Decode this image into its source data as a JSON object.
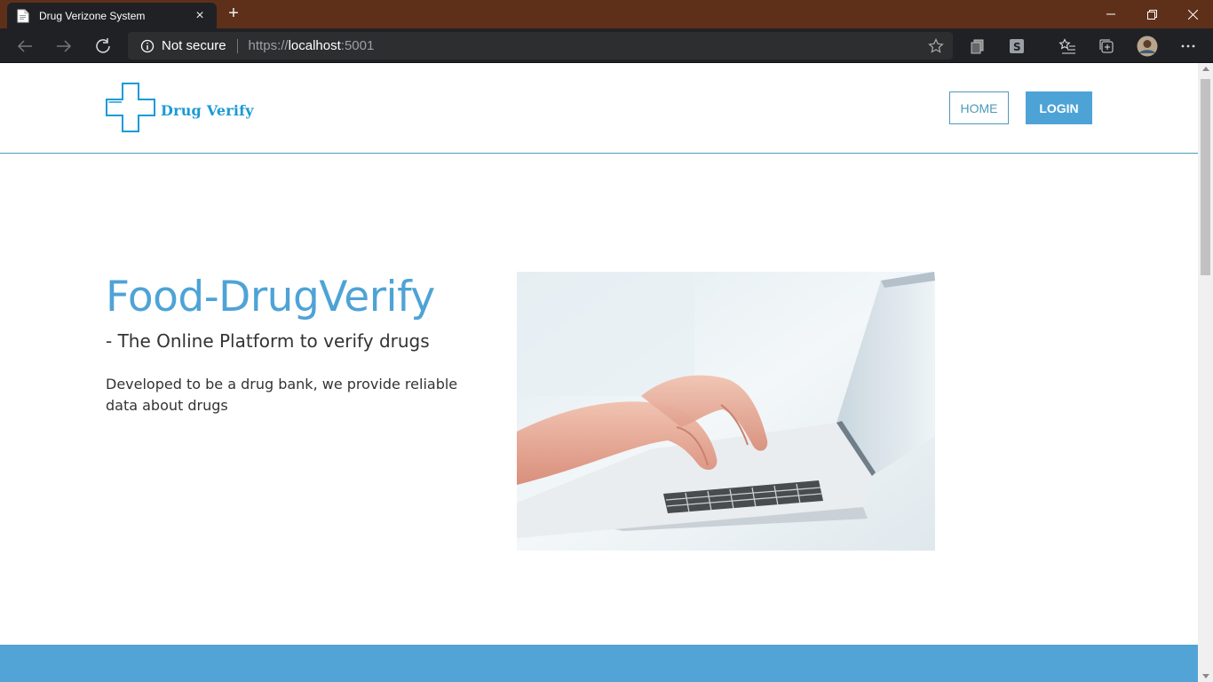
{
  "browser": {
    "tab_title": "Drug Verizone System",
    "new_tab_symbol": "+",
    "close_symbol": "×",
    "security_label": "Not secure",
    "url_prefix": "https://",
    "url_host": "localhost",
    "url_port": ":5001"
  },
  "site": {
    "logo_text": "Drug Verify",
    "nav": {
      "home_label": "HOME",
      "login_label": "LOGIN"
    },
    "hero": {
      "title": "Food-DrugVerify",
      "subtitle": "- The Online Platform to verify drugs",
      "description": "Developed to be a drug bank, we provide reliable data about drugs"
    }
  },
  "colors": {
    "accent": "#4ea3d6",
    "titlebar": "#5e301a",
    "toolbar": "#202124",
    "logo_blue": "#1a9ad6"
  },
  "icons": [
    "page-icon",
    "back-icon",
    "forward-icon",
    "refresh-icon",
    "info-icon",
    "star-icon",
    "collections-icon",
    "extension-icon",
    "favorites-icon",
    "tab-actions-icon",
    "profile-icon",
    "more-icon",
    "medical-cross-icon",
    "laptop-typing-image"
  ]
}
